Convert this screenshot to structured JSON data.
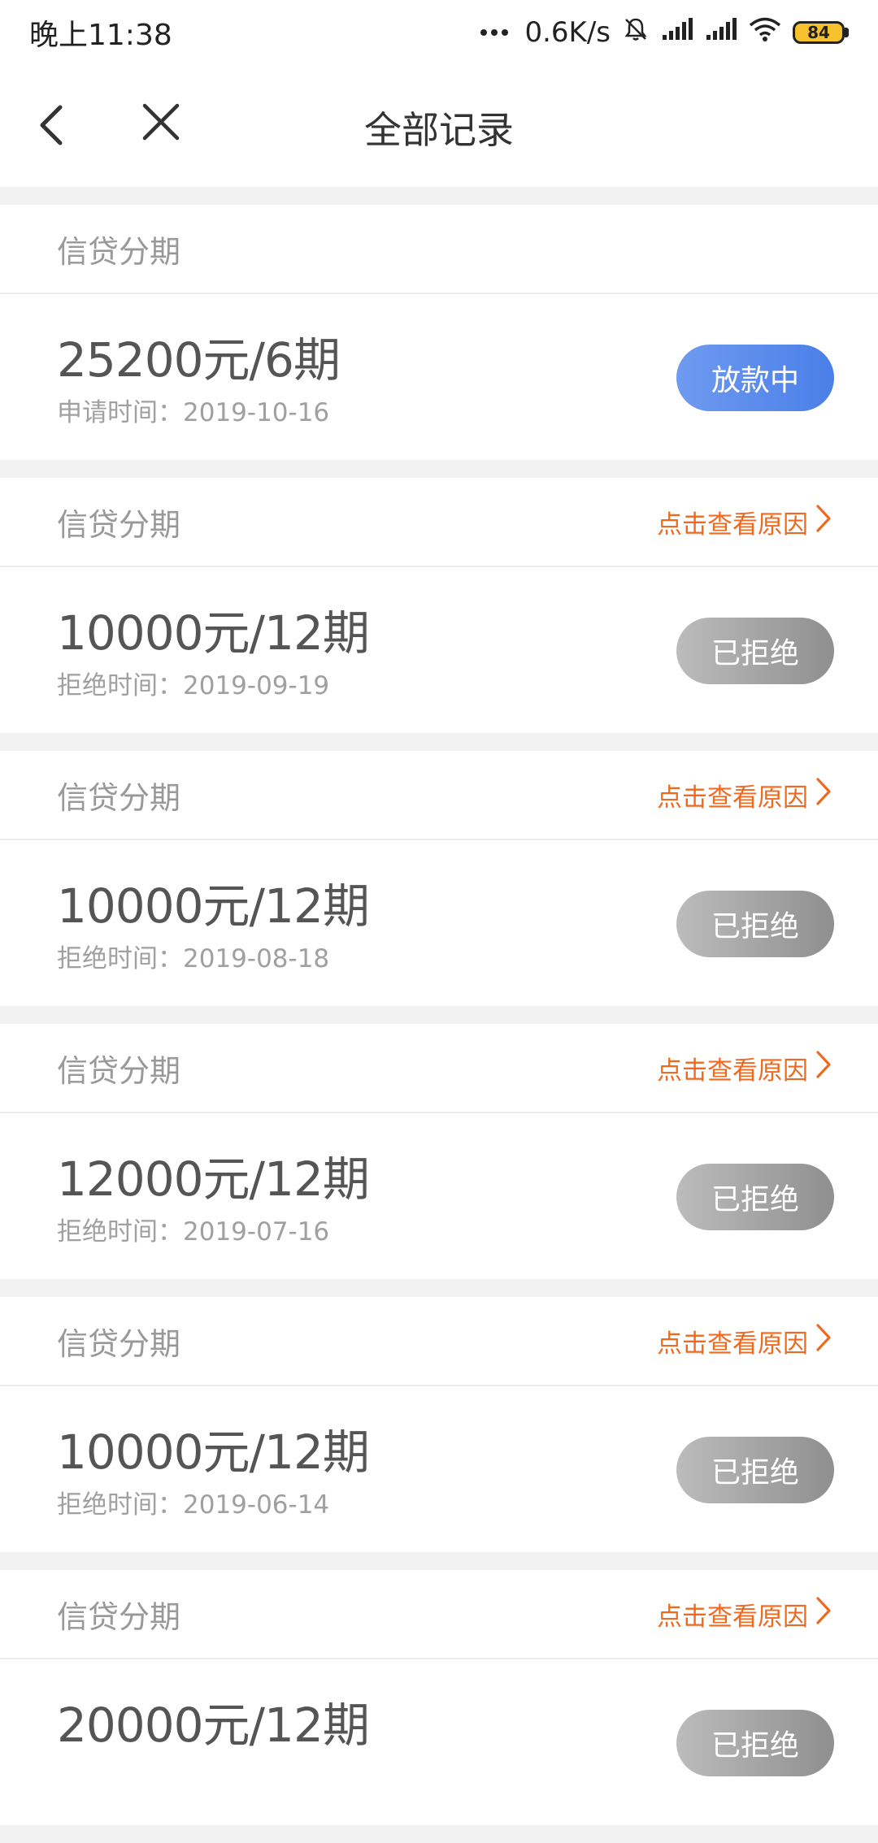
{
  "status_bar": {
    "time": "晚上11:38",
    "net_speed": "0.6K/s",
    "battery": "84",
    "icons": [
      "more-dots-icon",
      "mute-bell-icon",
      "signal-icon",
      "signal-icon",
      "wifi-icon",
      "battery-icon"
    ]
  },
  "header": {
    "title": "全部记录",
    "back_icon": "back-arrow-icon",
    "close_icon": "close-icon"
  },
  "colors": {
    "accent_orange": "#ef6a21",
    "pill_blue": "#4a7fe8",
    "pill_gray": "#9a9a9a"
  },
  "records": [
    {
      "type": "信贷分期",
      "reason_link": "",
      "amount": "25200元/6期",
      "date": "申请时间：2019-10-16",
      "status": "放款中",
      "status_style": "blue"
    },
    {
      "type": "信贷分期",
      "reason_link": "点击查看原因",
      "amount": "10000元/12期",
      "date": "拒绝时间：2019-09-19",
      "status": "已拒绝",
      "status_style": "gray"
    },
    {
      "type": "信贷分期",
      "reason_link": "点击查看原因",
      "amount": "10000元/12期",
      "date": "拒绝时间：2019-08-18",
      "status": "已拒绝",
      "status_style": "gray"
    },
    {
      "type": "信贷分期",
      "reason_link": "点击查看原因",
      "amount": "12000元/12期",
      "date": "拒绝时间：2019-07-16",
      "status": "已拒绝",
      "status_style": "gray"
    },
    {
      "type": "信贷分期",
      "reason_link": "点击查看原因",
      "amount": "10000元/12期",
      "date": "拒绝时间：2019-06-14",
      "status": "已拒绝",
      "status_style": "gray"
    },
    {
      "type": "信贷分期",
      "reason_link": "点击查看原因",
      "amount": "20000元/12期",
      "date": "",
      "status": "已拒绝",
      "status_style": "gray"
    }
  ]
}
